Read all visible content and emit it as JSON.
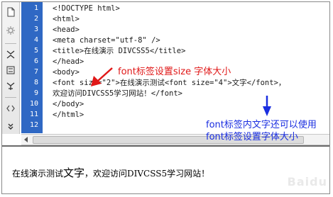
{
  "toolbar": {
    "icons": [
      "new-document-icon",
      "settings-icon",
      "collapse-tags-icon",
      "expand-tags-icon",
      "select-parent-icon",
      "wrap-tag-icon",
      "more-icon"
    ]
  },
  "editor": {
    "line_numbers": [
      "1",
      "2",
      "3",
      "4",
      "5",
      "6",
      "7",
      "8",
      "9",
      "10",
      "11",
      "12"
    ],
    "lines": [
      "<!DOCTYPE html>",
      "<html>",
      "<head>",
      "<meta charset=\"utf-8\" />",
      "<title>在线演示 DIVCSS5</title>",
      "</head>",
      "<body>",
      "<font size=\"2\">在线演示测试<font size=\"4\">文字</font>，",
      "欢迎访问DIVCSS5学习网站！</font>",
      "</body>",
      "</html>",
      ""
    ],
    "gutter_color": "#2f68c4"
  },
  "annotations": {
    "red_text": "font标签设置size 字体大小",
    "red_color": "#e01818",
    "blue_text": "font标签内文字还可以使用font标签设置字体大小",
    "blue_color": "#1a2ee0"
  },
  "preview": {
    "before": "在线演示测试",
    "big": "文字",
    "after": "，欢迎访问DIVCSS5学习网站！"
  }
}
